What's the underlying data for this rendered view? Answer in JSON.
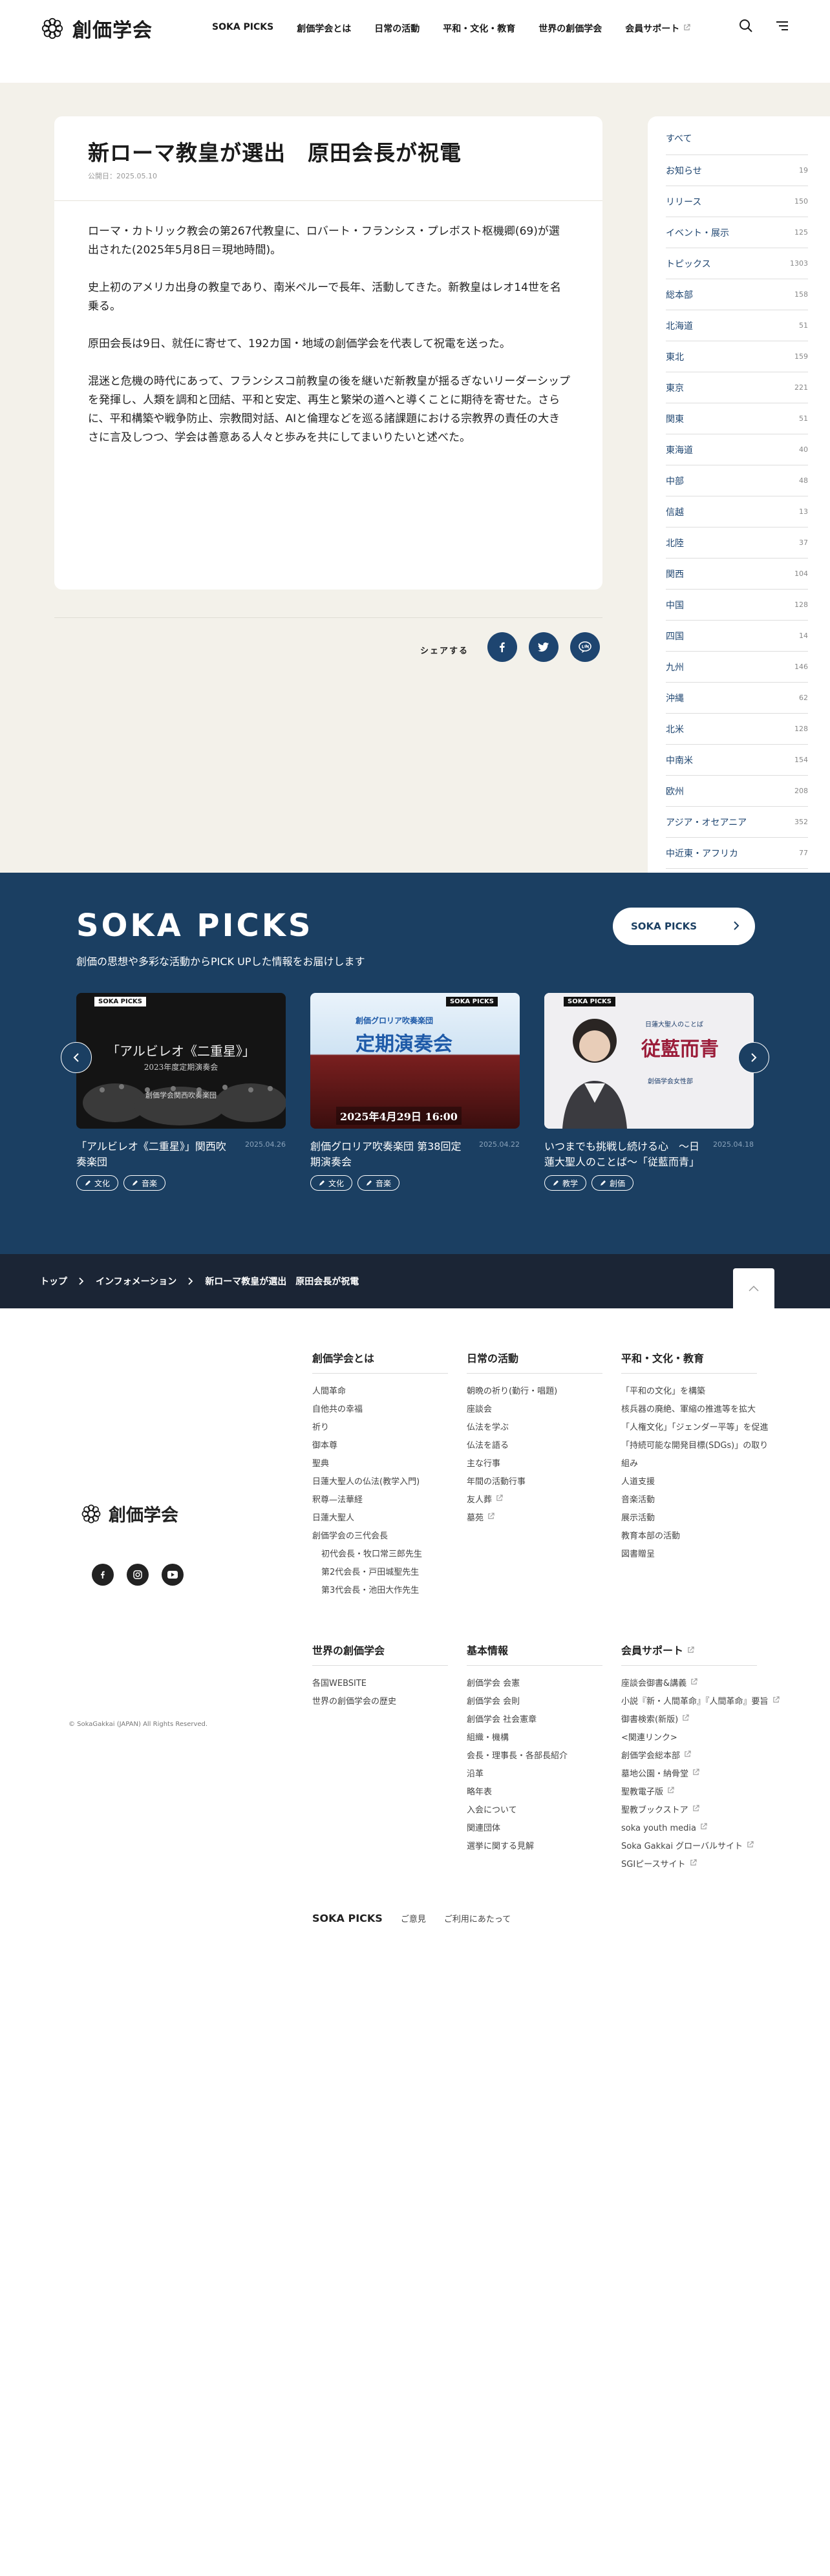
{
  "header": {
    "logo_text": "創価学会",
    "nav": [
      "SOKA PICKS",
      "創価学会とは",
      "日常の活動",
      "平和・文化・教育",
      "世界の創価学会",
      "会員サポート"
    ]
  },
  "article": {
    "title": "新ローマ教皇が選出　原田会長が祝電",
    "date": "公開日：2025.05.10",
    "paragraphs": [
      "ローマ・カトリック教会の第267代教皇に、ロバート・フランシス・プレボスト枢機卿(69)が選出された(2025年5月8日＝現地時間)。",
      "史上初のアメリカ出身の教皇であり、南米ペルーで長年、活動してきた。新教皇はレオ14世を名乗る。",
      "原田会長は9日、就任に寄せて、192カ国・地域の創価学会を代表して祝電を送った。",
      "混迷と危機の時代にあって、フランシスコ前教皇の後を継いだ新教皇が揺るぎないリーダーシップを発揮し、人類を調和と団結、平和と安定、再生と繁栄の道へと導くことに期待を寄せた。さらに、平和構築や戦争防止、宗教間対話、AIと倫理などを巡る諸課題における宗教界の責任の大きさに言及しつつ、学会は善意ある人々と歩みを共にしてまいりたいと述べた。"
    ],
    "share_label": "シェアする"
  },
  "sidebar": [
    {
      "label": "すべて",
      "count": ""
    },
    {
      "label": "お知らせ",
      "count": "19"
    },
    {
      "label": "リリース",
      "count": "150"
    },
    {
      "label": "イベント・展示",
      "count": "125"
    },
    {
      "label": "トピックス",
      "count": "1303"
    },
    {
      "label": "総本部",
      "count": "158"
    },
    {
      "label": "北海道",
      "count": "51"
    },
    {
      "label": "東北",
      "count": "159"
    },
    {
      "label": "東京",
      "count": "221"
    },
    {
      "label": "関東",
      "count": "51"
    },
    {
      "label": "東海道",
      "count": "40"
    },
    {
      "label": "中部",
      "count": "48"
    },
    {
      "label": "信越",
      "count": "13"
    },
    {
      "label": "北陸",
      "count": "37"
    },
    {
      "label": "関西",
      "count": "104"
    },
    {
      "label": "中国",
      "count": "128"
    },
    {
      "label": "四国",
      "count": "14"
    },
    {
      "label": "九州",
      "count": "146"
    },
    {
      "label": "沖縄",
      "count": "62"
    },
    {
      "label": "北米",
      "count": "128"
    },
    {
      "label": "中南米",
      "count": "154"
    },
    {
      "label": "欧州",
      "count": "208"
    },
    {
      "label": "アジア・オセアニア",
      "count": "352"
    },
    {
      "label": "中近東・アフリカ",
      "count": "77"
    }
  ],
  "picks": {
    "title": "SOKA PICKS",
    "subtitle": "創価の思想や多彩な活動からPICK UPした情報をお届けします",
    "button": "SOKA PICKS",
    "badge": "SOKA PICKS",
    "cards": [
      {
        "title": "「アルビレオ《二重星》」関西吹奏楽団",
        "date": "2025.04.26",
        "tags": [
          "文化",
          "音楽"
        ],
        "thumb_text": "「アルビレオ《二重星》」",
        "thumb_sub": "2023年度定期演奏会",
        "thumb_caption": "創価学会関西吹奏楽団"
      },
      {
        "title": "創価グロリア吹奏楽団 第38回定期演奏会",
        "date": "2025.04.22",
        "tags": [
          "文化",
          "音楽"
        ],
        "thumb_text": "定期演奏会",
        "thumb_sub": "創価グロリア吹奏楽団",
        "thumb_caption": "2025年4月29日 16:00"
      },
      {
        "title": "いつまでも挑戦し続ける心　〜日蓮大聖人のことば〜「従藍而青」",
        "date": "2025.04.18",
        "tags": [
          "教学",
          "創価"
        ],
        "thumb_text": "従藍而青",
        "thumb_sub": "日蓮大聖人のことば",
        "thumb_caption": "創価学会女性部"
      }
    ]
  },
  "breadcrumb": [
    "トップ",
    "インフォメーション",
    "新ローマ教皇が選出　原田会長が祝電"
  ],
  "footer": {
    "logo_text": "創価学会",
    "copyright": "© SokaGakkai (JAPAN) All Rights Reserved.",
    "col1": {
      "heading": "創価学会とは",
      "links": [
        "人間革命",
        "自他共の幸福",
        "祈り",
        "御本尊",
        "聖典",
        "日蓮大聖人の仏法(教学入門)",
        "釈尊—法華経",
        "日蓮大聖人",
        "創価学会の三代会長",
        "初代会長・牧口常三郎先生",
        "第2代会長・戸田城聖先生",
        "第3代会長・池田大作先生"
      ]
    },
    "col2": {
      "heading": "日常の活動",
      "links": [
        "朝晩の祈り(勤行・唱題)",
        "座談会",
        "仏法を学ぶ",
        "仏法を語る",
        "主な行事",
        "年間の活動行事",
        "友人葬",
        "墓苑"
      ]
    },
    "col3": {
      "heading": "平和・文化・教育",
      "links": [
        "「平和の文化」を構築",
        "核兵器の廃絶、軍縮の推進等を拡大",
        "「人権文化」「ジェンダー平等」を促進",
        "「持続可能な開発目標(SDGs)」の取り組み",
        "人道支援",
        "音楽活動",
        "展示活動",
        "教育本部の活動",
        "図書贈呈"
      ]
    },
    "col4": {
      "heading": "世界の創価学会",
      "links": [
        "各国WEBSITE",
        "世界の創価学会の歴史"
      ]
    },
    "col5": {
      "heading": "基本情報",
      "links": [
        "創価学会 会憲",
        "創価学会 会則",
        "創価学会 社会憲章",
        "組織・機構",
        "会長・理事長・各部長紹介",
        "沿革",
        "略年表",
        "入会について",
        "関連団体",
        "選挙に関する見解"
      ]
    },
    "col6": {
      "heading": "会員サポート",
      "links": [
        "座談会御書&講義",
        "小説『新・人間革命』『人間革命』要旨",
        "御書検索(新版)",
        "<関連リンク>",
        "創価学会総本部",
        "墓地公園・納骨堂",
        "聖教電子版",
        "聖教ブックストア",
        "soka youth media",
        "Soka Gakkai グローバルサイト",
        "SGIピースサイト"
      ]
    },
    "bottom_links": [
      "SOKA PICKS",
      "ご意見",
      "ご利用にあたって"
    ]
  }
}
